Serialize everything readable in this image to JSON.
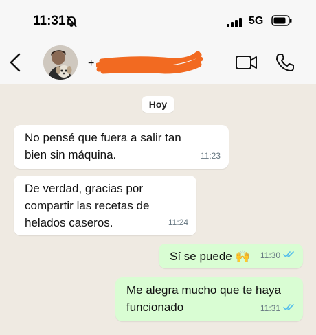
{
  "status_bar": {
    "time": "11:31",
    "network": "5G"
  },
  "header": {
    "contact_name": "+ "
  },
  "chat": {
    "date_label": "Hoy",
    "messages": [
      {
        "direction": "in",
        "lines": [
          "No pensé que fuera a salir tan",
          "bien sin máquina."
        ],
        "time": "11:23"
      },
      {
        "direction": "in",
        "lines": [
          "De verdad, gracias por",
          "compartir las recetas de",
          "helados caseros."
        ],
        "time": "11:24"
      },
      {
        "direction": "out",
        "lines": [
          "Sí se puede 🙌"
        ],
        "time": "11:30",
        "read": true
      },
      {
        "direction": "out",
        "lines": [
          "Me alegra mucho que te haya",
          "funcionado"
        ],
        "time": "11:31",
        "read": true
      }
    ]
  },
  "colors": {
    "incoming": "#ffffff",
    "outgoing": "#d9fdd3",
    "chat_bg": "#efeae2",
    "read_ticks": "#53bdeb",
    "redaction": "#f26a21"
  },
  "icons": {
    "bell": "bell-slash-icon",
    "signal": "signal-icon",
    "battery": "battery-icon",
    "back": "chevron-left-icon",
    "video": "video-camera-icon",
    "call": "phone-icon"
  }
}
